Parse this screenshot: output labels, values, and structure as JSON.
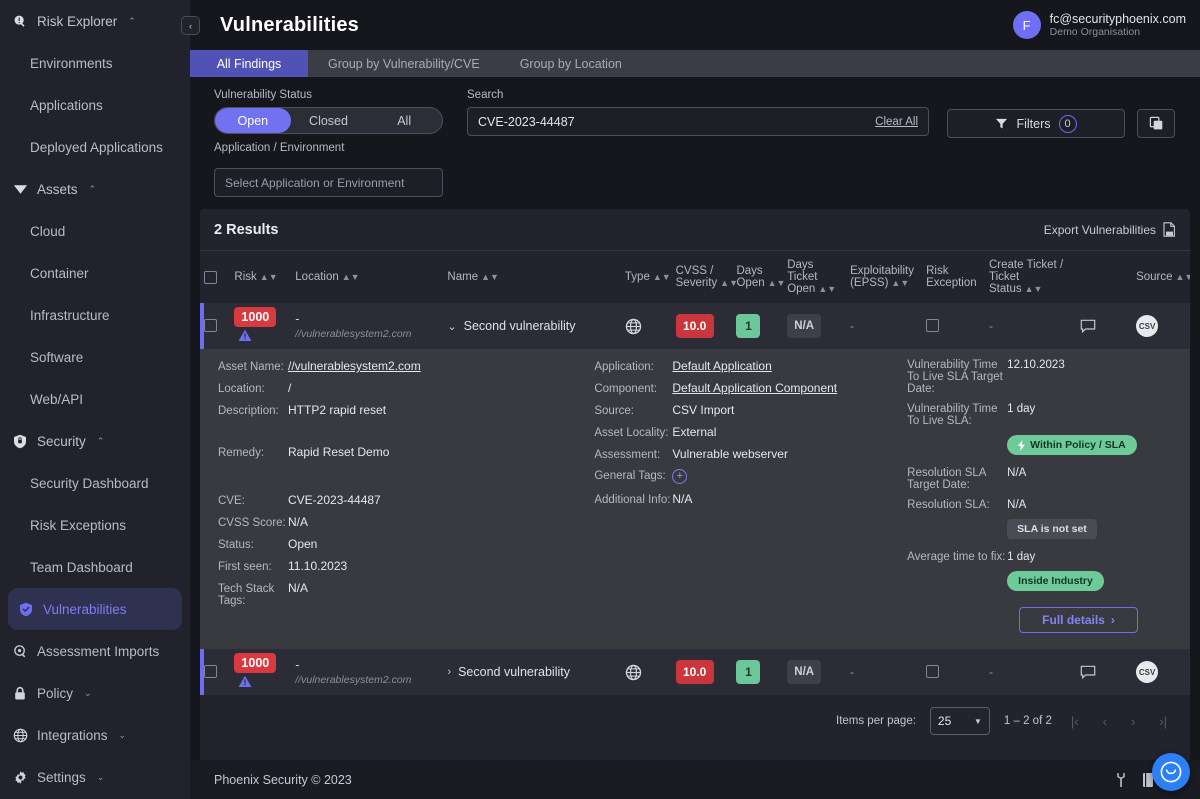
{
  "sidebar": {
    "groups": [
      {
        "icon": "risk-explorer-icon",
        "label": "Risk Explorer",
        "caret": "⌃",
        "items": [
          {
            "label": "Environments"
          },
          {
            "label": "Applications"
          },
          {
            "label": "Deployed Applications"
          }
        ]
      },
      {
        "icon": "assets-icon",
        "label": "Assets",
        "caret": "⌃",
        "items": [
          {
            "label": "Cloud"
          },
          {
            "label": "Container"
          },
          {
            "label": "Infrastructure"
          },
          {
            "label": "Software"
          },
          {
            "label": "Web/API"
          }
        ]
      },
      {
        "icon": "security-icon",
        "label": "Security",
        "caret": "⌃",
        "items": [
          {
            "label": "Security Dashboard"
          },
          {
            "label": "Risk Exceptions"
          },
          {
            "label": "Team Dashboard"
          }
        ]
      }
    ],
    "vulnerabilities": {
      "label": "Vulnerabilities",
      "icon": "shield-check-icon",
      "active": true
    },
    "standalone": [
      {
        "label": "Assessment Imports",
        "icon": "assessment-imports-icon",
        "caret": ""
      },
      {
        "label": "Policy",
        "icon": "lock-icon",
        "caret": "⌄"
      },
      {
        "label": "Integrations",
        "icon": "globe-icon",
        "caret": "⌄"
      },
      {
        "label": "Settings",
        "icon": "gear-icon",
        "caret": "⌄"
      }
    ]
  },
  "header": {
    "title": "Vulnerabilities",
    "collapse_icon": "‹",
    "user": {
      "initial": "F",
      "email": "fc@securityphoenix.com",
      "org": "Demo Organisation"
    }
  },
  "tabs": [
    {
      "label": "All Findings",
      "active": true
    },
    {
      "label": "Group by Vulnerability/CVE",
      "active": false
    },
    {
      "label": "Group by Location",
      "active": false
    }
  ],
  "filters": {
    "status_label": "Vulnerability Status",
    "status_options": [
      {
        "label": "Open",
        "active": true
      },
      {
        "label": "Closed",
        "active": false
      },
      {
        "label": "All",
        "active": false
      }
    ],
    "appenv_label": "Application / Environment",
    "appenv_placeholder": "Select Application or Environment",
    "search_label": "Search",
    "search_value": "CVE-2023-44487",
    "clear_all": "Clear All",
    "filters_button": "Filters",
    "filters_count": "0",
    "copy_icon": "copy-icon"
  },
  "results": {
    "count_label": "2 Results",
    "export_label": "Export Vulnerabilities",
    "export_icon": "csv-export-icon",
    "columns": [
      {
        "label": "Risk",
        "sortable": true
      },
      {
        "label": "Location",
        "sortable": true
      },
      {
        "label": "Name",
        "sortable": true
      },
      {
        "label": "Type",
        "sortable": true
      },
      {
        "label": "CVSS / Severity",
        "sortable": true
      },
      {
        "label": "Days Open",
        "sortable": true
      },
      {
        "label": "Days Ticket Open",
        "sortable": true
      },
      {
        "label": "Exploitability (EPSS)",
        "sortable": true
      },
      {
        "label": "Risk Exception",
        "sortable": false
      },
      {
        "label": "Create Ticket / Ticket Status",
        "sortable": true
      },
      {
        "label": "Source",
        "sortable": true
      }
    ],
    "rows": [
      {
        "risk": "1000",
        "risk_icon": "warning-triangle-icon",
        "location_main": "-",
        "location_sub": "//vulnerablesystem2.com",
        "name": "Second vulnerability",
        "expanded": true,
        "twisty": "⌄",
        "type_icon": "globe-icon",
        "cvss": "10.0",
        "days_open": "1",
        "days_ticket_open": "N/A",
        "epss": "-",
        "risk_exception": "checkbox",
        "ticket_status": "-",
        "comment_icon": "comment-icon",
        "source": "CSV"
      },
      {
        "risk": "1000",
        "risk_icon": "warning-triangle-icon",
        "location_main": "-",
        "location_sub": "//vulnerablesystem2.com",
        "name": "Second vulnerability",
        "expanded": false,
        "twisty": "›",
        "type_icon": "globe-icon",
        "cvss": "10.0",
        "days_open": "1",
        "days_ticket_open": "N/A",
        "epss": "-",
        "risk_exception": "checkbox",
        "ticket_status": "-",
        "comment_icon": "comment-icon",
        "source": "CSV"
      }
    ]
  },
  "detail": {
    "col1": [
      {
        "key": "Asset Name:",
        "value": "//vulnerablesystem2.com",
        "link": true
      },
      {
        "key": "Location:",
        "value": "/"
      },
      {
        "key": "Description:",
        "value": "HTTP2 rapid reset"
      },
      {
        "key": "Remedy:",
        "value": "Rapid Reset Demo"
      },
      {
        "key": "CVE:",
        "value": "CVE-2023-44487"
      },
      {
        "key": "CVSS Score:",
        "value": "N/A"
      },
      {
        "key": "Status:",
        "value": "Open"
      },
      {
        "key": "First seen:",
        "value": "11.10.2023"
      },
      {
        "key": "Tech Stack Tags:",
        "value": "N/A"
      }
    ],
    "col2": [
      {
        "key": "Application:",
        "value": "Default Application",
        "link": true
      },
      {
        "key": "Component:",
        "value": "Default Application Component",
        "link": true
      },
      {
        "key": "Source:",
        "value": "CSV Import"
      },
      {
        "key": "Asset Locality:",
        "value": "External"
      },
      {
        "key": "Assessment:",
        "value": "Vulnerable webserver"
      },
      {
        "key": "General Tags:",
        "value": "+",
        "tagbutton": true
      },
      {
        "key": "Additional Info:",
        "value": "N/A"
      }
    ],
    "col3": [
      {
        "key": "Vulnerability Time To Live SLA Target Date:",
        "value": "12.10.2023"
      },
      {
        "key": "Vulnerability Time To Live SLA:",
        "value": "1 day"
      },
      {
        "key": "",
        "value": "Within Policy / SLA",
        "pill": "green",
        "pill_icon": "bolt-icon"
      },
      {
        "key": "Resolution SLA Target Date:",
        "value": "N/A"
      },
      {
        "key": "Resolution SLA:",
        "value": "N/A"
      },
      {
        "key": "",
        "value": "SLA is not set",
        "pill": "grey"
      },
      {
        "key": "Average time to fix:",
        "value": "1 day"
      },
      {
        "key": "",
        "value": "Inside Industry",
        "pill": "green"
      }
    ],
    "full_details_label": "Full details",
    "full_details_arrow": "›"
  },
  "pagination": {
    "items_per_page_label": "Items per page:",
    "items_per_page_value": "25",
    "range_label": "1 – 2 of 2",
    "first": "|‹",
    "prev": "‹",
    "next": "›",
    "last": "›|"
  },
  "footer": {
    "copyright": "Phoenix Security © 2023",
    "icons": [
      "wrench-icon",
      "book-icon",
      "video-icon"
    ],
    "chat_icon": "chat-bubble-icon"
  }
}
